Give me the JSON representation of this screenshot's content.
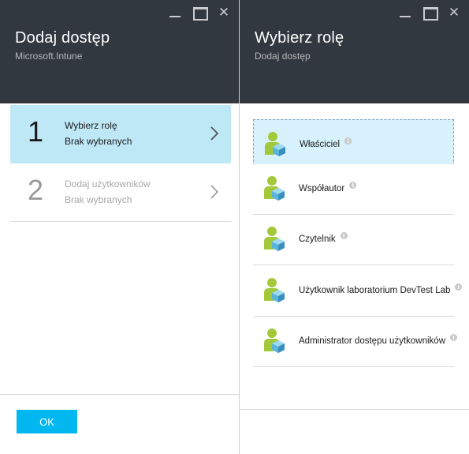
{
  "left_blade": {
    "title": "Dodaj dostęp",
    "subtitle": "Microsoft.Intune",
    "steps": [
      {
        "number": "1",
        "title": "Wybierz rolę",
        "status": "Brak wybranych",
        "active": true
      },
      {
        "number": "2",
        "title": "Dodaj użytkowników",
        "status": "Brak wybranych",
        "active": false
      }
    ],
    "ok_label": "OK"
  },
  "right_blade": {
    "title": "Wybierz rolę",
    "subtitle": "Dodaj dostęp",
    "roles": [
      {
        "label": "Właściciel",
        "icon": "role-user-icon",
        "selected": true
      },
      {
        "label": "Współautor",
        "icon": "role-user-icon",
        "selected": false
      },
      {
        "label": "Czytelnik",
        "icon": "role-user-icon",
        "selected": false
      },
      {
        "label": "Użytkownik laboratorium DevTest Lab",
        "icon": "role-user-icon",
        "selected": false
      },
      {
        "label": "Administrator dostępu użytkowników",
        "icon": "role-user-icon",
        "selected": false
      }
    ]
  },
  "window_controls": {
    "minimize_icon": "minimize-icon",
    "maximize_icon": "maximize-icon",
    "close_icon": "close-icon"
  },
  "colors": {
    "header_bg": "#32383f",
    "accent": "#00b7f0",
    "selected_step_bg": "#bfe8f7",
    "selected_role_bg": "#d7f2fc",
    "role_icon_green": "#a3c93a",
    "role_icon_blue": "#59b4d9"
  }
}
